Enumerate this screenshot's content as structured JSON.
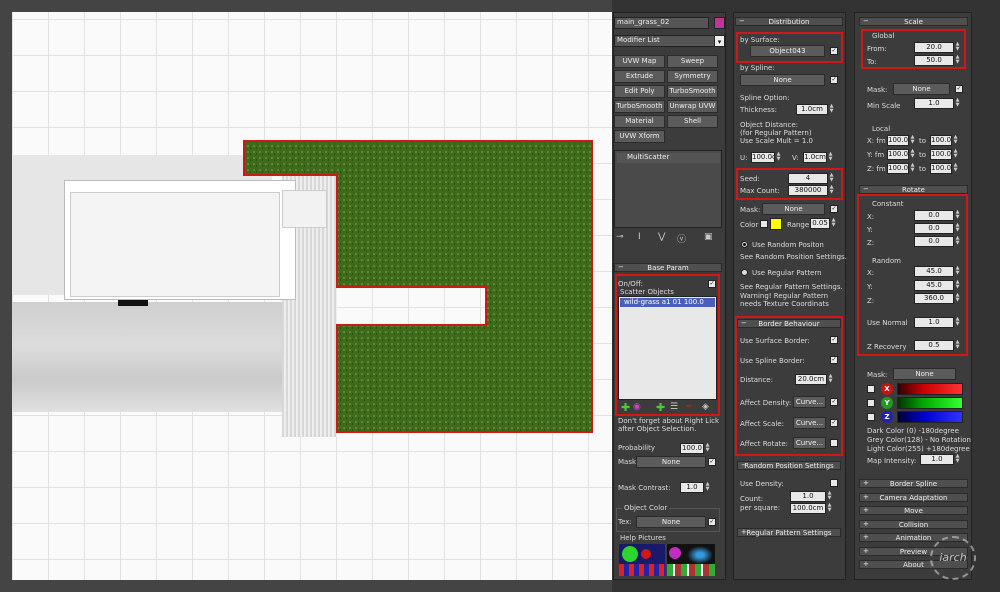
{
  "object": {
    "name": "main_grass_02",
    "color": "#c0359a"
  },
  "modifier_list": {
    "label": "Modifier List",
    "buttons": [
      "UVW Map",
      "Sweep",
      "Extrude",
      "Symmetry",
      "Edit Poly",
      "TurboSmooth",
      "TurboSmooth",
      "Unwrap UVW",
      "Material",
      "Shell",
      "UVW Xform"
    ]
  },
  "stack": {
    "item": "MultiScatter"
  },
  "base_param": {
    "title": "Base Param",
    "on_off_label": "On/Off:",
    "on_off": true,
    "scatter_objects_label": "Scatter Objects",
    "scatter_item": "wild-grass a1 01 100.0",
    "note": "Don't forget about Right Lick after Object Selection.",
    "probability_label": "Probability",
    "probability": "100.0",
    "mask_label": "Mask",
    "mask_value": "None",
    "mask_contrast_label": "Mask Contrast:",
    "mask_contrast": "1.0",
    "object_color_label": "Object Color",
    "tex_label": "Tex:",
    "tex_value": "None",
    "help_pictures_label": "Help Pictures"
  },
  "distribution": {
    "title": "Distribution",
    "by_surface_label": "by Surface:",
    "surface_object": "Object043",
    "by_spline_label": "by Spline:",
    "spline_value": "None",
    "spline_option_label": "Spline Option:",
    "thickness_label": "Thickness:",
    "thickness": "1.0cm",
    "object_distance_label": "Object Distance:",
    "regular_pattern_label": "(for Regular Pattern)",
    "use_scale_mult_label": "Use Scale Mult = 1.0",
    "u_label": "U:",
    "u_value": "100.0cr",
    "v_label": "V:",
    "v_value": "1.0cm",
    "seed_label": "Seed:",
    "seed": "4",
    "max_count_label": "Max Count:",
    "max_count": "380000",
    "mask_label": "Mask:",
    "mask_value": "None",
    "color_label": "Color",
    "range_label": "Range",
    "range_value": "0.05",
    "swatch_color": "#ffff00",
    "use_random_label": "Use Random Positon",
    "see_random_label": "See Random Position Settings.",
    "use_regular_label": "Use Regular Pattern",
    "see_regular_label": "See Regular Pattern Settings.",
    "warning1": "Warning! Regular Pattern",
    "warning2": "needs Texture Coordinats"
  },
  "border_behaviour": {
    "title": "Border Behaviour",
    "use_surface_border": "Use Surface Border:",
    "use_spline_border": "Use Spline Border:",
    "distance_label": "Distance:",
    "distance": "20.0cm",
    "affect_density": "Affect Density:",
    "affect_scale": "Affect Scale:",
    "affect_rotate": "Affect Rotate:",
    "curve_label": "Curve..."
  },
  "random_position": {
    "title": "Random Position Settings",
    "use_density_label": "Use Density:",
    "count_label": "Count:",
    "count_value": "1.0",
    "per_square_label": "per square:",
    "per_square_value": "100.0cm"
  },
  "regular_pattern_title": "Regular Pattern Settings",
  "scale": {
    "title": "Scale",
    "global_label": "Global",
    "from_label": "From:",
    "from_value": "20.0",
    "to_label": "To:",
    "to_value": "50.0",
    "mask_label": "Mask:",
    "mask_value": "None",
    "min_scale_label": "Min Scale",
    "min_scale_value": "1.0",
    "local_label": "Local",
    "x_label": "X: fm",
    "y_label": "Y: fm",
    "z_label": "Z: fm",
    "to_short": "to",
    "val100": "100.0"
  },
  "rotate": {
    "title": "Rotate",
    "constant_label": "Constant",
    "cx": "0.0",
    "cy": "0.0",
    "cz": "0.0",
    "random_label": "Random",
    "rx": "45.0",
    "ry": "45.0",
    "rz": "360.0",
    "x_label": "X:",
    "y_label": "Y:",
    "z_label": "Z:",
    "use_normal_label": "Use Normal",
    "use_normal_value": "1.0",
    "z_recovery_label": "Z Recovery",
    "z_recovery_value": "0.5",
    "mask_label": "Mask:",
    "mask_value": "None",
    "dark_color_text": "Dark Color (0)   -180degree",
    "grey_color_text": "Grey Color(128) - No Rotation",
    "light_color_text": "Light Color(255)  +180degree",
    "map_intensity_label": "Map Intensity:",
    "map_intensity_value": "1.0"
  },
  "rollouts": [
    "Border Spline",
    "Camera Adaptation",
    "Move",
    "Collision",
    "Animation",
    "Preview",
    "About"
  ],
  "watermark": "iarch"
}
